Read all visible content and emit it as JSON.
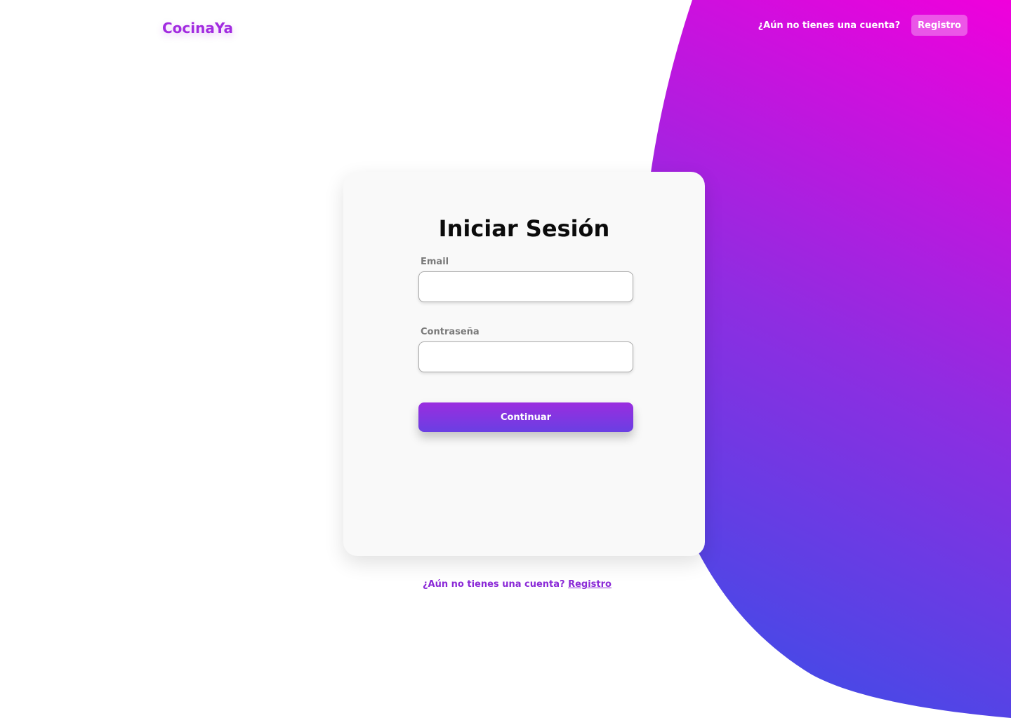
{
  "brand": {
    "name": "CocinaYa"
  },
  "top_nav": {
    "question": "¿Aún no tienes una cuenta?",
    "register_label": "Registro"
  },
  "login": {
    "title": "Iniciar Sesión",
    "email_label": "Email",
    "email_value": "",
    "password_label": "Contraseña",
    "password_value": "",
    "continue_label": "Continuar"
  },
  "bottom_register": {
    "question": "¿Aún no tienes una cuenta?",
    "link_label": "Registro"
  },
  "colors": {
    "brand": "#a22be0",
    "gradient_blue": "#3f4ce7",
    "gradient_purple": "#8e2de1",
    "gradient_pink": "#f000dc",
    "card_background": "#f9f9f9"
  }
}
